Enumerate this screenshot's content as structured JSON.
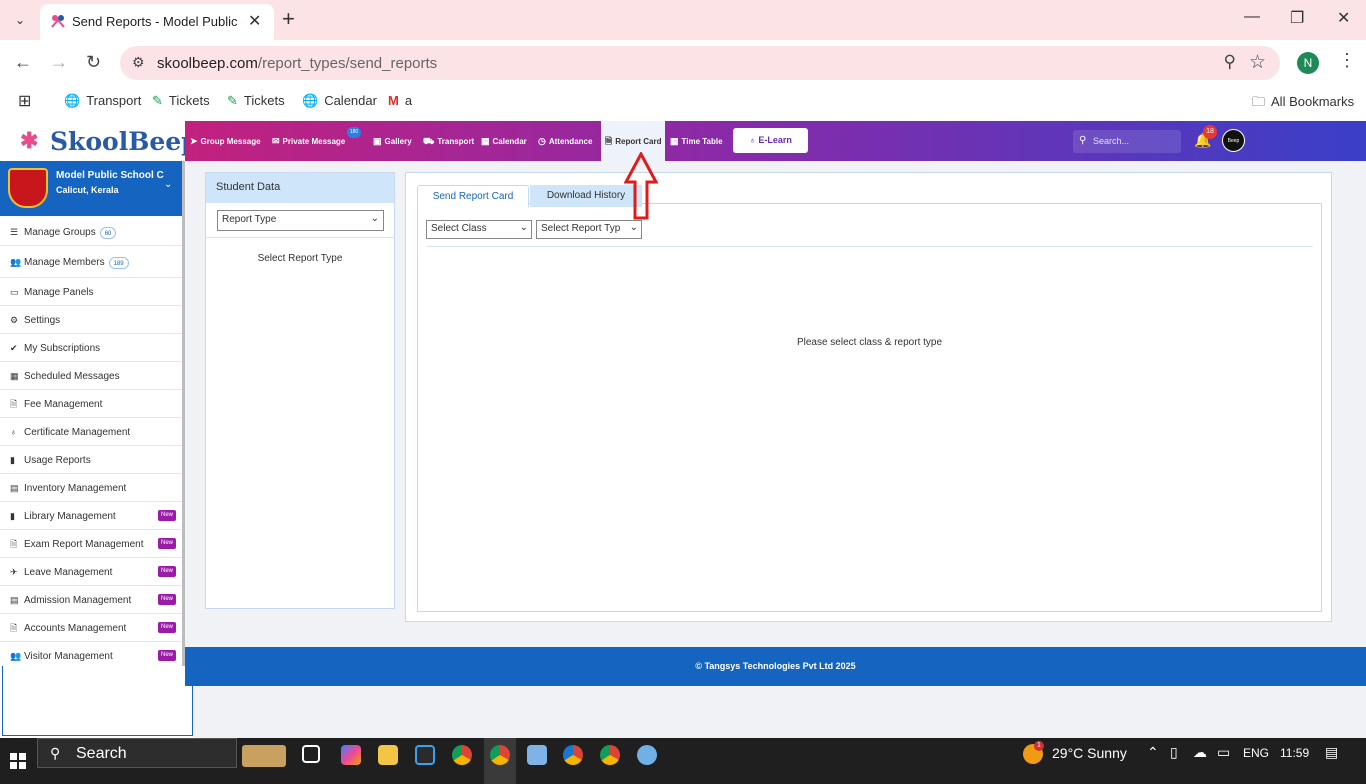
{
  "browser": {
    "tab_title": "Send Reports - Model Public Sc",
    "url_host": "skoolbeep.com",
    "url_path": "/report_types/send_reports",
    "profile_initial": "N",
    "bookmarks": [
      "Transport",
      "Tickets",
      "Tickets",
      "Calendar",
      "a"
    ],
    "all_bookmarks": "All Bookmarks"
  },
  "app": {
    "logo_text": "SkoolBeep",
    "nav": [
      {
        "label": "Group Message"
      },
      {
        "label": "Private Message",
        "badge": "180"
      },
      {
        "label": "Gallery"
      },
      {
        "label": "Transport"
      },
      {
        "label": "Calendar"
      },
      {
        "label": "Attendance"
      },
      {
        "label": "Report Card",
        "active": true
      },
      {
        "label": "Time Table"
      }
    ],
    "elearn": "E-Learn",
    "search_placeholder": "Search...",
    "notification_count": "18",
    "avatar_text": "Beep"
  },
  "sidebar": {
    "school_name": "Model Public School C",
    "school_location": "Calicut, Kerala",
    "items": [
      {
        "label": "Manage Groups",
        "count": "60"
      },
      {
        "label": "Manage Members",
        "count": "189"
      },
      {
        "label": "Manage Panels"
      },
      {
        "label": "Settings"
      },
      {
        "label": "My Subscriptions"
      },
      {
        "label": "Scheduled Messages"
      },
      {
        "label": "Fee Management"
      },
      {
        "label": "Certificate Management"
      },
      {
        "label": "Usage Reports"
      },
      {
        "label": "Inventory Management"
      },
      {
        "label": "Library Management",
        "new": "New"
      },
      {
        "label": "Exam Report Management",
        "new": "New"
      },
      {
        "label": "Leave Management",
        "new": "New"
      },
      {
        "label": "Admission Management",
        "new": "New"
      },
      {
        "label": "Accounts Management",
        "new": "New"
      },
      {
        "label": "Visitor Management",
        "new": "New"
      }
    ]
  },
  "student_panel": {
    "title": "Student Data",
    "select_value": "Report Type",
    "message": "Select Report Type"
  },
  "main_panel": {
    "tabs": [
      "Send Report Card",
      "Download History"
    ],
    "select_class": "Select Class",
    "select_report_type": "Select Report Typ",
    "message": "Please select class & report type"
  },
  "footer": "© Tangsys Technologies Pvt Ltd 2025",
  "taskbar": {
    "search": "Search",
    "weather_badge": "1",
    "weather": "29°C  Sunny",
    "lang": "ENG",
    "time": "11:59"
  },
  "colors": {
    "primary": "#1565c0",
    "nav_gradient_start": "#c2217e",
    "nav_gradient_end": "#3a3fc8",
    "arrow": "#e01b1b",
    "new_badge": "#9c1aa8"
  }
}
